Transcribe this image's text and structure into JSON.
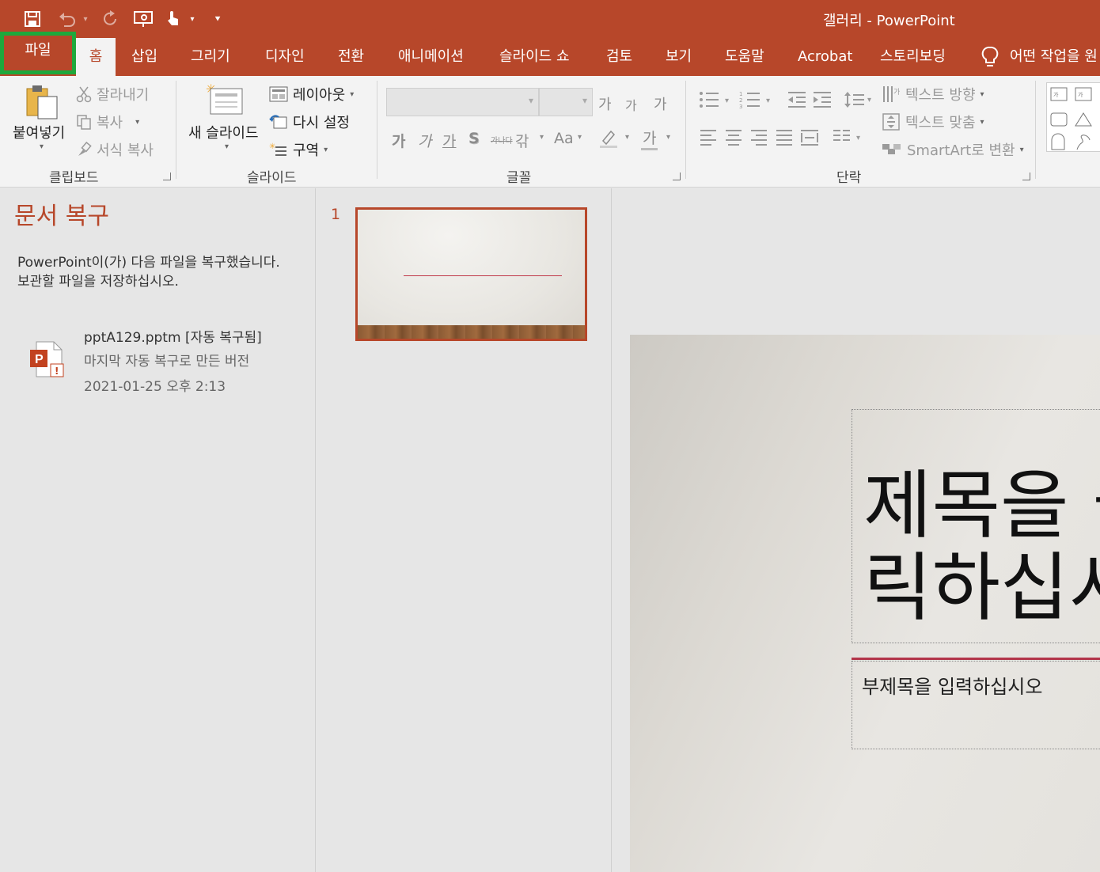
{
  "window": {
    "title": "갤러리  -  PowerPoint"
  },
  "qat": {
    "icons": [
      "save-icon",
      "undo-icon",
      "redo-icon",
      "present-from-start-icon",
      "touch-mode-icon",
      "customize-qat-icon"
    ]
  },
  "tabs": {
    "file": "파일",
    "home": "홈",
    "insert": "삽입",
    "draw": "그리기",
    "design": "디자인",
    "transitions": "전환",
    "animations": "애니메이션",
    "slideshow": "슬라이드 쇼",
    "review": "검토",
    "view": "보기",
    "help": "도움말",
    "acrobat": "Acrobat",
    "storyboard": "스토리보딩",
    "tellme": "어떤 작업을 원"
  },
  "ribbon": {
    "clipboard": {
      "paste": "붙여넣기",
      "cut": "잘라내기",
      "copy": "복사",
      "format_painter": "서식 복사",
      "label": "클립보드"
    },
    "slides": {
      "new_slide": "새 슬라이드",
      "layout": "레이아웃",
      "reset": "다시 설정",
      "section": "구역",
      "label": "슬라이드"
    },
    "font": {
      "grow": "가",
      "shrink": "가",
      "clear": "가",
      "bold": "가",
      "italic": "가",
      "underline": "가",
      "shadow": "S",
      "strike": "가나다",
      "spacing": "갂",
      "case": "Aa",
      "font_color": "가",
      "label": "글꼴"
    },
    "paragraph": {
      "text_direction": "텍스트 방향",
      "align_text": "텍스트 맞춤",
      "smartart": "SmartArt로 변환",
      "label": "단락"
    }
  },
  "recovery": {
    "title": "문서 복구",
    "description": "PowerPoint이(가) 다음 파일을 복구했습니다. 보관할 파일을 저장하십시오.",
    "file": {
      "name": "pptA129.pptm  [자동 복구됨]",
      "subtitle": "마지막 자동 복구로 만든 버전",
      "date": "2021-01-25 오후 2:13"
    }
  },
  "thumbnails": {
    "slide_number": "1"
  },
  "slide": {
    "title": "제목을 클\n릭하십시",
    "subtitle": "부제목을 입력하십시오"
  }
}
